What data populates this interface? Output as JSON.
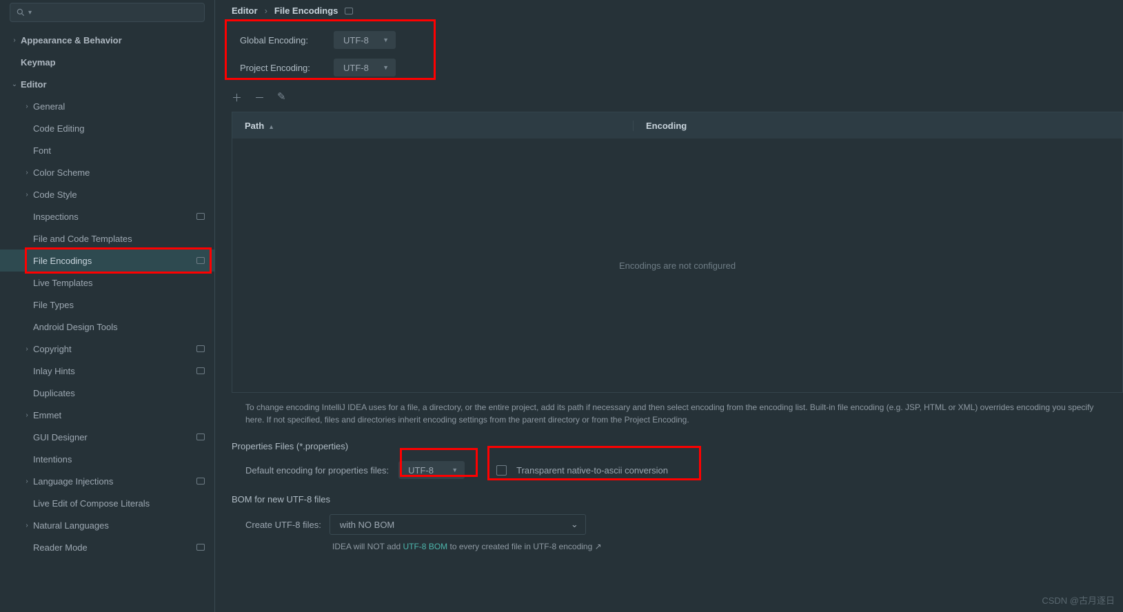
{
  "breadcrumb": {
    "root": "Editor",
    "leaf": "File Encodings"
  },
  "sidebar": {
    "items": [
      {
        "label": "Appearance & Behavior",
        "depth": 0,
        "chev": "›",
        "bold": true
      },
      {
        "label": "Keymap",
        "depth": 0,
        "chev": "",
        "bold": true
      },
      {
        "label": "Editor",
        "depth": 0,
        "chev": "⌄",
        "bold": true
      },
      {
        "label": "General",
        "depth": 1,
        "chev": "›"
      },
      {
        "label": "Code Editing",
        "depth": 1,
        "chev": ""
      },
      {
        "label": "Font",
        "depth": 1,
        "chev": ""
      },
      {
        "label": "Color Scheme",
        "depth": 1,
        "chev": "›"
      },
      {
        "label": "Code Style",
        "depth": 1,
        "chev": "›"
      },
      {
        "label": "Inspections",
        "depth": 1,
        "chev": "",
        "badge": true
      },
      {
        "label": "File and Code Templates",
        "depth": 1,
        "chev": ""
      },
      {
        "label": "File Encodings",
        "depth": 1,
        "chev": "",
        "badge": true,
        "selected": true
      },
      {
        "label": "Live Templates",
        "depth": 1,
        "chev": ""
      },
      {
        "label": "File Types",
        "depth": 1,
        "chev": ""
      },
      {
        "label": "Android Design Tools",
        "depth": 1,
        "chev": ""
      },
      {
        "label": "Copyright",
        "depth": 1,
        "chev": "›",
        "badge": true
      },
      {
        "label": "Inlay Hints",
        "depth": 1,
        "chev": "",
        "badge": true
      },
      {
        "label": "Duplicates",
        "depth": 1,
        "chev": ""
      },
      {
        "label": "Emmet",
        "depth": 1,
        "chev": "›"
      },
      {
        "label": "GUI Designer",
        "depth": 1,
        "chev": "",
        "badge": true
      },
      {
        "label": "Intentions",
        "depth": 1,
        "chev": ""
      },
      {
        "label": "Language Injections",
        "depth": 1,
        "chev": "›",
        "badge": true
      },
      {
        "label": "Live Edit of Compose Literals",
        "depth": 1,
        "chev": ""
      },
      {
        "label": "Natural Languages",
        "depth": 1,
        "chev": "›"
      },
      {
        "label": "Reader Mode",
        "depth": 1,
        "chev": "",
        "badge": true
      }
    ]
  },
  "encodings": {
    "global_label": "Global Encoding:",
    "global_value": "UTF-8",
    "project_label": "Project Encoding:",
    "project_value": "UTF-8"
  },
  "toolbar": {
    "add": "＋",
    "remove": "－",
    "edit": "✎"
  },
  "table": {
    "path_header": "Path",
    "enc_header": "Encoding",
    "empty_text": "Encodings are not configured"
  },
  "hint": "To change encoding IntelliJ IDEA uses for a file, a directory, or the entire project, add its path if necessary and then select encoding from the encoding list. Built-in file encoding (e.g. JSP, HTML or XML) overrides encoding you specify here. If not specified, files and directories inherit encoding settings from the parent directory or from the Project Encoding.",
  "properties": {
    "section": "Properties Files (*.properties)",
    "default_label": "Default encoding for properties files:",
    "default_value": "UTF-8",
    "transparent_label": "Transparent native-to-ascii conversion"
  },
  "bom": {
    "section": "BOM for new UTF-8 files",
    "create_label": "Create UTF-8 files:",
    "create_value": "with NO BOM",
    "note_pre": "IDEA will NOT add ",
    "note_link": "UTF-8 BOM",
    "note_post": " to every created file in UTF-8 encoding ↗"
  },
  "watermark": "CSDN @古月逐日"
}
